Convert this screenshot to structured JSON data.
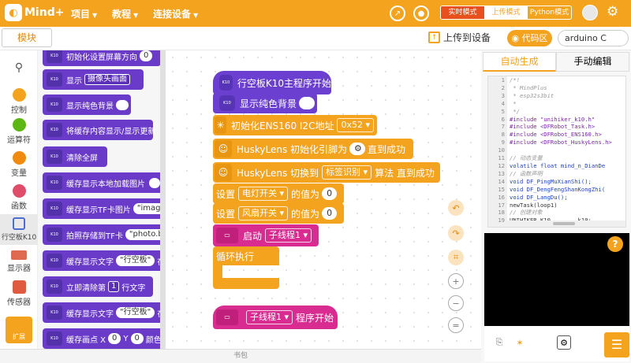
{
  "app": {
    "logo": "Mind+",
    "menus": [
      "项目",
      "教程",
      "连接设备"
    ]
  },
  "modes": [
    "实时模式",
    "上传模式",
    "Python模式"
  ],
  "modebar": {
    "module_btn": "模块",
    "upload": "上传到设备",
    "code_area": "代码区",
    "board": "arduino C"
  },
  "categories": [
    "控制",
    "运算符",
    "变量",
    "函数",
    "行空板K10",
    "显示器",
    "传感器",
    "扩展"
  ],
  "category_colors": [
    "#f4a31f",
    "#5cb712",
    "#f08b10",
    "#e04d6a",
    "#4b6fd1",
    "#e06a4f",
    "#e05a3f"
  ],
  "palette": [
    {
      "text": "初始化设置屏幕方向",
      "pill": "0"
    },
    {
      "text": "显示",
      "dd": "摄像头画面"
    },
    {
      "text": "显示纯色背景"
    },
    {
      "text": "将缓存内容显示/显示更新"
    },
    {
      "text": "清除全屏"
    },
    {
      "text": "缓存显示本地加载图片"
    },
    {
      "text": "缓存显示TF卡图片",
      "pill": "\"image.p"
    },
    {
      "text": "拍照存储到TF卡",
      "pill": "\"photo.bm"
    },
    {
      "text": "缓存显示文字",
      "pill": "\"行空板\"",
      "tail": "在"
    },
    {
      "text": "立即清除第",
      "dd": "1",
      "tail": "行文字"
    },
    {
      "text": "缓存显示文字",
      "pill": "\"行空板\"",
      "tail": "在"
    },
    {
      "text": "缓存画点 X",
      "pill": "0",
      "text2": "Y",
      "pill2": "0",
      "tail": "颜色"
    }
  ],
  "canvas": {
    "k10_start": "行空板K10主程序开始",
    "show_bg": "显示纯色背景",
    "ens160_init": "初始化ENS160 I2C地址",
    "ens160_addr": "0x52",
    "husky_init": "HuskyLens 初始化引脚为",
    "husky_init_tail": "直到成功",
    "husky_switch": "HuskyLens 切换到",
    "husky_algo": "标签识别",
    "husky_switch_tail": "算法 直到成功",
    "set1": "设置",
    "var1": "电灯开关",
    "val_of": "的值为",
    "val1": "0",
    "set2": "设置",
    "var2": "风扇开关",
    "val2": "0",
    "start": "启动",
    "thread": "子线程1",
    "loop": "循环执行",
    "thread_hat": "子线程1",
    "thread_hat_tail": "程序开始"
  },
  "bottom_label": "书包",
  "right": {
    "tabs": [
      "自动生成",
      "手动编辑"
    ],
    "line_numbers": [
      "1",
      "2",
      "3",
      "4",
      "5",
      "6",
      "7",
      "8",
      "9",
      "10",
      "11",
      "12",
      "13",
      "14",
      "15",
      "16",
      "17",
      "18",
      "19"
    ],
    "code": [
      {
        "t": "/*!",
        "cls": "c"
      },
      {
        "t": " * MindPlus",
        "cls": "c"
      },
      {
        "t": " * esp32s3bit",
        "cls": "c"
      },
      {
        "t": " *",
        "cls": "c"
      },
      {
        "t": " */",
        "cls": "c"
      },
      {
        "t": "#include \"unihiker_k10.h\"",
        "cls": "k2"
      },
      {
        "t": "#include <DFRobot_Task.h>",
        "cls": "k2"
      },
      {
        "t": "#include <DFRobot_ENS160.h>",
        "cls": "k2"
      },
      {
        "t": "#include <DFRobot_HuskyLens.h>",
        "cls": "k2"
      },
      {
        "t": "",
        "cls": ""
      },
      {
        "t": "// 动态变量",
        "cls": "c"
      },
      {
        "t": "volatile float mind_n_DianDe",
        "cls": "s"
      },
      {
        "t": "// 函数声明",
        "cls": "c"
      },
      {
        "t": "void DF_PingMuXianShi();",
        "cls": "s"
      },
      {
        "t": "void DF_DengFengShanKongZhi(",
        "cls": "s"
      },
      {
        "t": "void DF_LangDu();",
        "cls": "s"
      },
      {
        "t": "newTask(loop1)",
        "cls": ""
      },
      {
        "t": "// 创建对象",
        "cls": "c"
      },
      {
        "t": "UNIHIKER_K10        k10;",
        "cls": ""
      }
    ]
  }
}
